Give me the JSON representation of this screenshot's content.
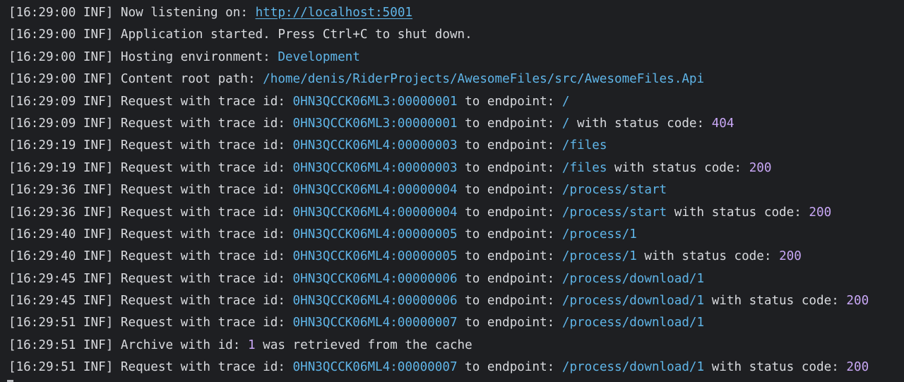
{
  "terminal": {
    "lines": [
      {
        "timestamp": "[16:29:00 INF]",
        "segments": [
          {
            "text": " Now listening on: ",
            "kind": "plain"
          },
          {
            "text": "http://localhost:5001",
            "kind": "link"
          }
        ]
      },
      {
        "timestamp": "[16:29:00 INF]",
        "segments": [
          {
            "text": " Application started. Press Ctrl+C to shut down.",
            "kind": "plain"
          }
        ]
      },
      {
        "timestamp": "[16:29:00 INF]",
        "segments": [
          {
            "text": " Hosting environment: ",
            "kind": "plain"
          },
          {
            "text": "Development",
            "kind": "value"
          }
        ]
      },
      {
        "timestamp": "[16:29:00 INF]",
        "segments": [
          {
            "text": " Content root path: ",
            "kind": "plain"
          },
          {
            "text": "/home/denis/RiderProjects/AwesomeFiles/src/AwesomeFiles.Api",
            "kind": "value"
          }
        ]
      },
      {
        "timestamp": "[16:29:09 INF]",
        "segments": [
          {
            "text": " Request with trace id: ",
            "kind": "plain"
          },
          {
            "text": "0HN3QCCK06ML3:00000001",
            "kind": "value"
          },
          {
            "text": " to endpoint: ",
            "kind": "plain"
          },
          {
            "text": "/",
            "kind": "value"
          }
        ]
      },
      {
        "timestamp": "[16:29:09 INF]",
        "segments": [
          {
            "text": " Request with trace id: ",
            "kind": "plain"
          },
          {
            "text": "0HN3QCCK06ML3:00000001",
            "kind": "value"
          },
          {
            "text": " to endpoint: ",
            "kind": "plain"
          },
          {
            "text": "/",
            "kind": "value"
          },
          {
            "text": " with status code: ",
            "kind": "plain"
          },
          {
            "text": "404",
            "kind": "number"
          }
        ]
      },
      {
        "timestamp": "[16:29:19 INF]",
        "segments": [
          {
            "text": " Request with trace id: ",
            "kind": "plain"
          },
          {
            "text": "0HN3QCCK06ML4:00000003",
            "kind": "value"
          },
          {
            "text": " to endpoint: ",
            "kind": "plain"
          },
          {
            "text": "/files",
            "kind": "value"
          }
        ]
      },
      {
        "timestamp": "[16:29:19 INF]",
        "segments": [
          {
            "text": " Request with trace id: ",
            "kind": "plain"
          },
          {
            "text": "0HN3QCCK06ML4:00000003",
            "kind": "value"
          },
          {
            "text": " to endpoint: ",
            "kind": "plain"
          },
          {
            "text": "/files",
            "kind": "value"
          },
          {
            "text": " with status code: ",
            "kind": "plain"
          },
          {
            "text": "200",
            "kind": "number"
          }
        ]
      },
      {
        "timestamp": "[16:29:36 INF]",
        "segments": [
          {
            "text": " Request with trace id: ",
            "kind": "plain"
          },
          {
            "text": "0HN3QCCK06ML4:00000004",
            "kind": "value"
          },
          {
            "text": " to endpoint: ",
            "kind": "plain"
          },
          {
            "text": "/process/start",
            "kind": "value"
          }
        ]
      },
      {
        "timestamp": "[16:29:36 INF]",
        "segments": [
          {
            "text": " Request with trace id: ",
            "kind": "plain"
          },
          {
            "text": "0HN3QCCK06ML4:00000004",
            "kind": "value"
          },
          {
            "text": " to endpoint: ",
            "kind": "plain"
          },
          {
            "text": "/process/start",
            "kind": "value"
          },
          {
            "text": " with status code: ",
            "kind": "plain"
          },
          {
            "text": "200",
            "kind": "number"
          }
        ]
      },
      {
        "timestamp": "[16:29:40 INF]",
        "segments": [
          {
            "text": " Request with trace id: ",
            "kind": "plain"
          },
          {
            "text": "0HN3QCCK06ML4:00000005",
            "kind": "value"
          },
          {
            "text": " to endpoint: ",
            "kind": "plain"
          },
          {
            "text": "/process/1",
            "kind": "value"
          }
        ]
      },
      {
        "timestamp": "[16:29:40 INF]",
        "segments": [
          {
            "text": " Request with trace id: ",
            "kind": "plain"
          },
          {
            "text": "0HN3QCCK06ML4:00000005",
            "kind": "value"
          },
          {
            "text": " to endpoint: ",
            "kind": "plain"
          },
          {
            "text": "/process/1",
            "kind": "value"
          },
          {
            "text": " with status code: ",
            "kind": "plain"
          },
          {
            "text": "200",
            "kind": "number"
          }
        ]
      },
      {
        "timestamp": "[16:29:45 INF]",
        "segments": [
          {
            "text": " Request with trace id: ",
            "kind": "plain"
          },
          {
            "text": "0HN3QCCK06ML4:00000006",
            "kind": "value"
          },
          {
            "text": " to endpoint: ",
            "kind": "plain"
          },
          {
            "text": "/process/download/1",
            "kind": "value"
          }
        ]
      },
      {
        "timestamp": "[16:29:45 INF]",
        "segments": [
          {
            "text": " Request with trace id: ",
            "kind": "plain"
          },
          {
            "text": "0HN3QCCK06ML4:00000006",
            "kind": "value"
          },
          {
            "text": " to endpoint: ",
            "kind": "plain"
          },
          {
            "text": "/process/download/1",
            "kind": "value"
          },
          {
            "text": " with status code: ",
            "kind": "plain"
          },
          {
            "text": "200",
            "kind": "number"
          }
        ]
      },
      {
        "timestamp": "[16:29:51 INF]",
        "segments": [
          {
            "text": " Request with trace id: ",
            "kind": "plain"
          },
          {
            "text": "0HN3QCCK06ML4:00000007",
            "kind": "value"
          },
          {
            "text": " to endpoint: ",
            "kind": "plain"
          },
          {
            "text": "/process/download/1",
            "kind": "value"
          }
        ]
      },
      {
        "timestamp": "[16:29:51 INF]",
        "segments": [
          {
            "text": " Archive with id: ",
            "kind": "plain"
          },
          {
            "text": "1",
            "kind": "number"
          },
          {
            "text": " was retrieved from the cache",
            "kind": "plain"
          }
        ]
      },
      {
        "timestamp": "[16:29:51 INF]",
        "segments": [
          {
            "text": " Request with trace id: ",
            "kind": "plain"
          },
          {
            "text": "0HN3QCCK06ML4:00000007",
            "kind": "value"
          },
          {
            "text": " to endpoint: ",
            "kind": "plain"
          },
          {
            "text": "/process/download/1",
            "kind": "value"
          },
          {
            "text": " with status code: ",
            "kind": "plain"
          },
          {
            "text": "200",
            "kind": "number"
          }
        ]
      }
    ]
  },
  "colors": {
    "background": "#1e1f22",
    "text": "#d8dade",
    "value": "#5fb5e8",
    "number": "#c8a7f5"
  }
}
